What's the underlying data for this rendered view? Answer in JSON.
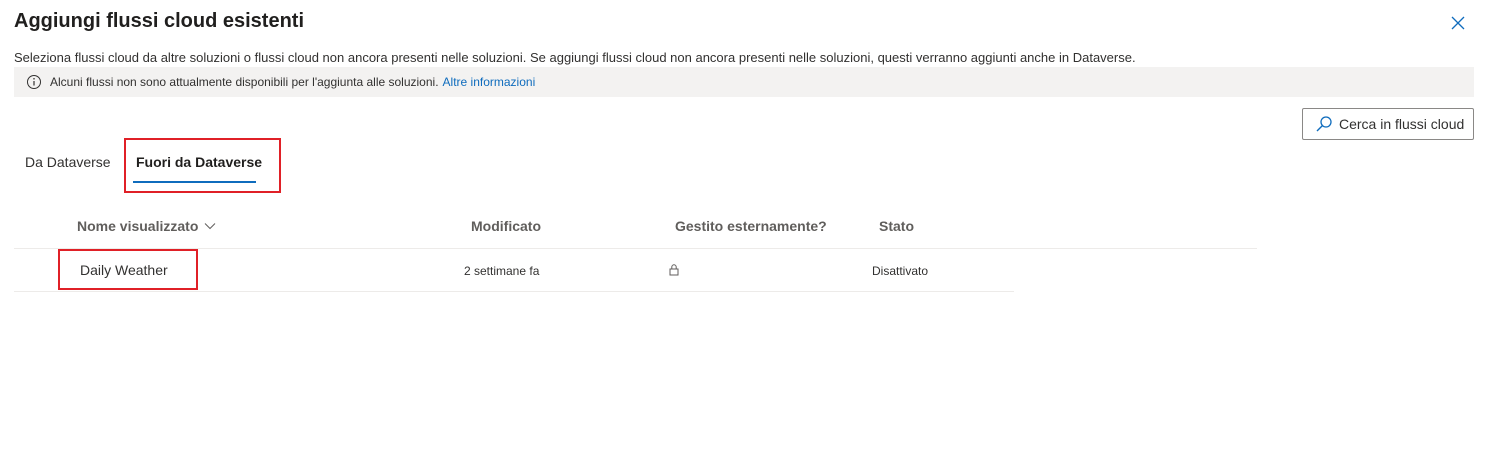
{
  "dialog": {
    "title": "Aggiungi flussi cloud esistenti",
    "description": "Seleziona flussi cloud da altre soluzioni o flussi cloud non ancora presenti nelle soluzioni. Se aggiungi flussi cloud non ancora presenti nelle soluzioni, questi verranno aggiunti anche in Dataverse.",
    "close_icon": "close-icon"
  },
  "info_bar": {
    "icon": "info-icon",
    "message": "Alcuni flussi non sono attualmente disponibili per l'aggiunta alle soluzioni.",
    "link_text": "Altre informazioni"
  },
  "search": {
    "icon": "search-icon",
    "label": "Cerca in flussi cloud"
  },
  "tabs": [
    {
      "label": "Da Dataverse",
      "selected": false
    },
    {
      "label": "Fuori da Dataverse",
      "selected": true
    }
  ],
  "table": {
    "columns": [
      {
        "label": "Nome visualizzato",
        "sortable": true
      },
      {
        "label": "Modificato"
      },
      {
        "label": "Gestito esternamente?"
      },
      {
        "label": "Stato"
      }
    ],
    "rows": [
      {
        "name": "Daily Weather",
        "modified": "2 settimane fa",
        "externally_managed_icon": "lock-icon",
        "state": "Disattivato"
      }
    ]
  },
  "colors": {
    "accent": "#0f6cbd",
    "highlight": "#e02027",
    "info_bar_bg": "#f3f2f1"
  }
}
